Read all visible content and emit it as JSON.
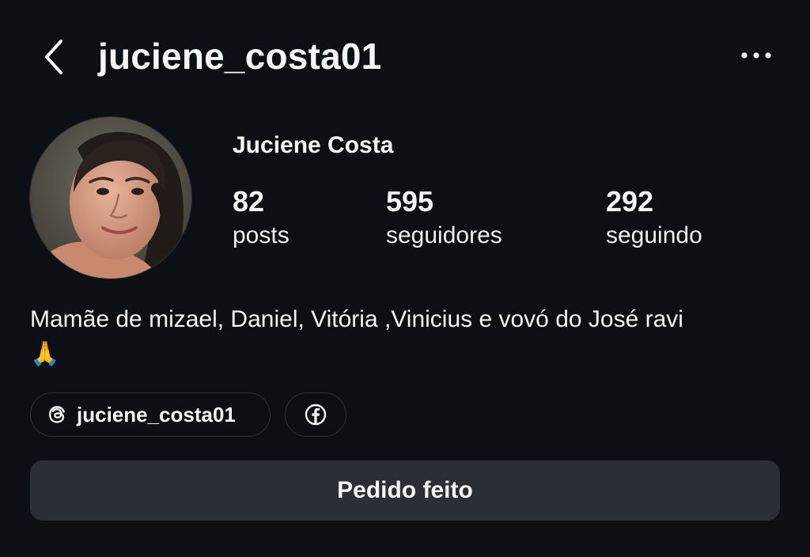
{
  "header": {
    "username": "juciene_costa01",
    "back_icon": "chevron-left-icon",
    "more_icon": "more-horizontal-icon"
  },
  "profile": {
    "full_name": "Juciene Costa",
    "avatar": "profile-photo"
  },
  "stats": {
    "posts": {
      "count": "82",
      "label": "posts"
    },
    "followers": {
      "count": "595",
      "label": "seguidores"
    },
    "following": {
      "count": "292",
      "label": "seguindo"
    }
  },
  "bio": {
    "text": "Mamãe de mizael, Daniel, Vitória ,Vinicius e vovó do José ravi",
    "emoji": "🙏"
  },
  "links": {
    "threads_handle": "juciene_costa01",
    "threads_icon": "threads-icon",
    "facebook_icon": "facebook-icon"
  },
  "actions": {
    "request_label": "Pedido feito"
  },
  "colors": {
    "background": "#0c0f14",
    "button_bg": "#2a2e35",
    "chip_border": "#2f333b",
    "text": "#f5f5f5"
  }
}
